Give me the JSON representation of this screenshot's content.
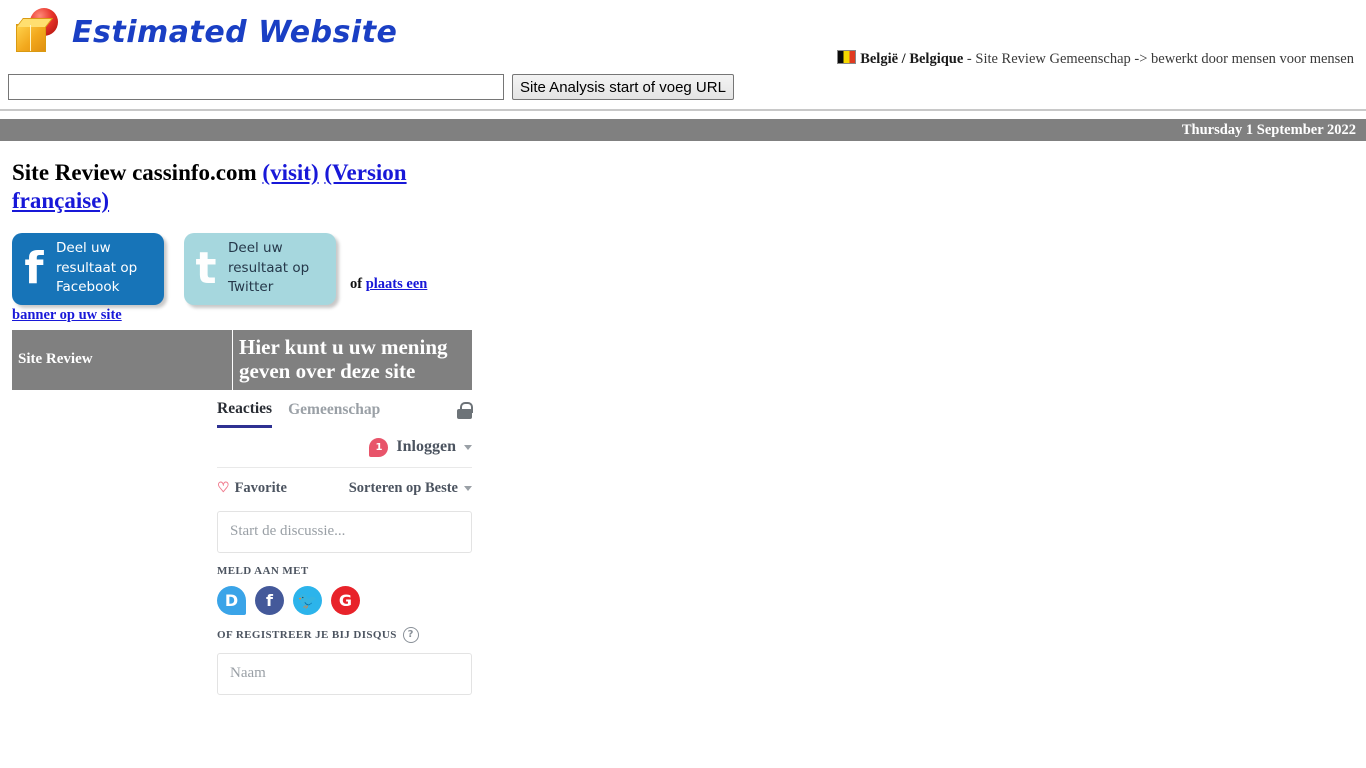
{
  "header": {
    "logo_text": "Estimated Website",
    "logo_sphere_color": "#e8342a",
    "logo_cube_color": "#f2a81d",
    "brand_color": "#1a3fc4",
    "country": "België / Belgique",
    "tagline_rest": " - Site Review Gemeenschap -> bewerkt door mensen voor mensen",
    "flag_icon": "belgium-flag-icon"
  },
  "search": {
    "value": "",
    "placeholder": "",
    "button_label": "Site Analysis start of voeg URL"
  },
  "date_bar": {
    "date": "Thursday 1 September 2022",
    "background": "#808080"
  },
  "title": {
    "prefix": "Site Review cassinfo.com ",
    "visit_link": "(visit)",
    "separator": " ",
    "french_link": "(Version française)"
  },
  "share": {
    "facebook": {
      "icon": "facebook-icon",
      "glyph": "f",
      "label": "Deel uw\nresultaat op\nFacebook",
      "color": "#1774b8"
    },
    "twitter": {
      "icon": "twitter-icon",
      "glyph": "t",
      "label": "Deel uw\nresultaat op\nTwitter",
      "color": "#a6d7de"
    },
    "of_text": "of ",
    "banner_link_part1": "plaats een",
    "banner_link_part2": "banner op uw site"
  },
  "review_table": {
    "left_label": "Site Review",
    "right_label": "Hier kunt u uw mening geven over deze site",
    "background": "#808080"
  },
  "disqus": {
    "tabs": [
      {
        "label": "Reacties",
        "active": true
      },
      {
        "label": "Gemeenschap",
        "active": false
      }
    ],
    "lock_icon": "lock-icon",
    "login_badge": "1",
    "login_label": "Inloggen",
    "favorite_label": "Favorite",
    "favorite_icon": "heart-icon",
    "sort_label": "Sorteren op Beste",
    "comment_placeholder": "Start de discussie...",
    "signin_caption": "MELD AAN MET",
    "socials": [
      {
        "name": "disqus-icon",
        "glyph": "D",
        "color": "#3aa4e8"
      },
      {
        "name": "facebook-icon",
        "glyph": "f",
        "color": "#44599a"
      },
      {
        "name": "twitter-icon",
        "glyph": "🐦",
        "color": "#2cb4eb"
      },
      {
        "name": "google-icon",
        "glyph": "G",
        "color": "#e8232a"
      }
    ],
    "register_caption": "OF REGISTREER JE BIJ DISQUS",
    "help_icon": "question-mark-icon",
    "name_placeholder": "Naam"
  }
}
